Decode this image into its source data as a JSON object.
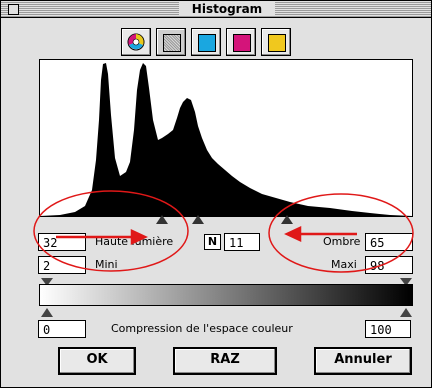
{
  "window": {
    "title": "Histogram"
  },
  "toolbar": {
    "buttons": [
      {
        "name": "rgb-mode-icon",
        "color": "#ffffff"
      },
      {
        "name": "gray-mode-icon",
        "color": "#bdbdbd"
      },
      {
        "name": "cyan-channel-icon",
        "color": "#1aa7e0"
      },
      {
        "name": "magenta-channel-icon",
        "color": "#d4147a"
      },
      {
        "name": "yellow-channel-icon",
        "color": "#f0c81e"
      }
    ]
  },
  "levels": {
    "highlight_value": "32",
    "highlight_label": "Haute lumière",
    "midtone_icon": "N",
    "midtone_value": "11",
    "shadow_label": "Ombre",
    "shadow_value": "65",
    "min_value": "2",
    "min_label": "Mini",
    "max_label": "Maxi",
    "max_value": "98"
  },
  "compression": {
    "min_value": "0",
    "label": "Compression de l'espace couleur",
    "max_value": "100"
  },
  "buttons": {
    "ok": "OK",
    "reset": "RAZ",
    "cancel": "Annuler"
  },
  "colors": {
    "annotation": "#e01818"
  }
}
